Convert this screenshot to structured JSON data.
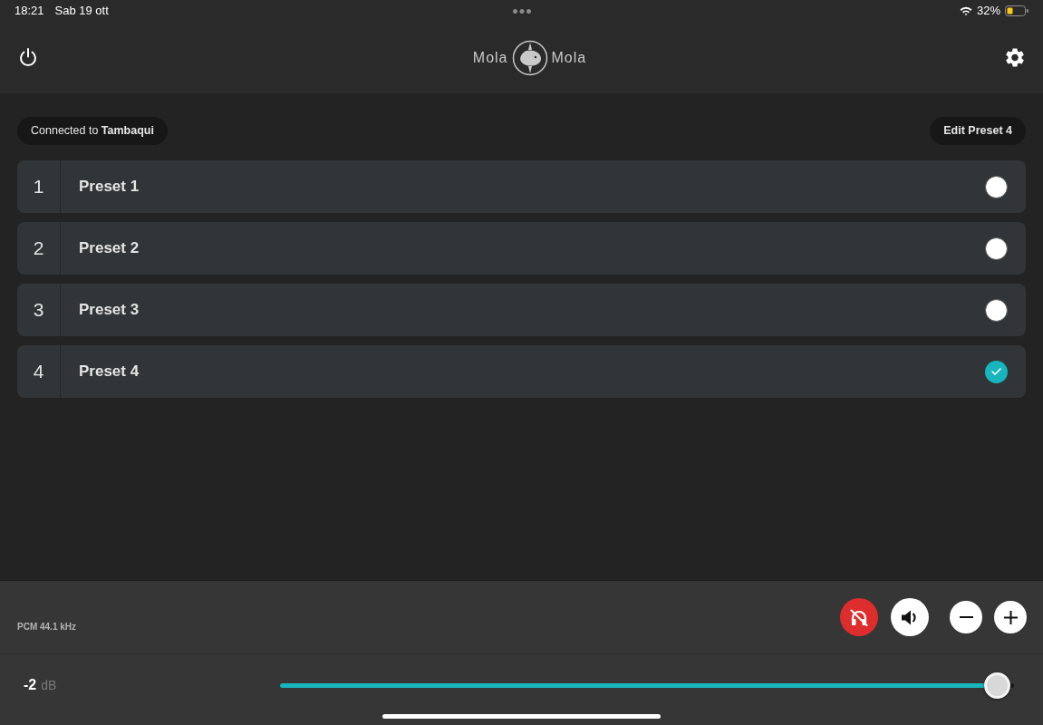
{
  "status_bar": {
    "time": "18:21",
    "date": "Sab 19 ott",
    "battery": "32%"
  },
  "header": {
    "logo": {
      "left": "Mola",
      "right": "Mola"
    }
  },
  "connection": {
    "label": "Connected to **Tambaqui**"
  },
  "edit_button": {
    "label": "Edit Preset 4"
  },
  "presets": [
    {
      "number": "1",
      "name": "Preset 1",
      "selected": false
    },
    {
      "number": "2",
      "name": "Preset 2",
      "selected": false
    },
    {
      "number": "3",
      "name": "Preset 3",
      "selected": false
    },
    {
      "number": "4",
      "name": "Preset 4",
      "selected": true
    }
  ],
  "footer": {
    "format": "PCM 44.1 kHz",
    "outputs": [
      {
        "kind": "headphones",
        "muted": true
      },
      {
        "kind": "speaker",
        "muted": false
      }
    ],
    "volume_steps": [
      {
        "kind": "minus"
      },
      {
        "kind": "plus"
      }
    ]
  },
  "volume": {
    "value": "-2",
    "unit": "dB",
    "level": 0.977
  }
}
